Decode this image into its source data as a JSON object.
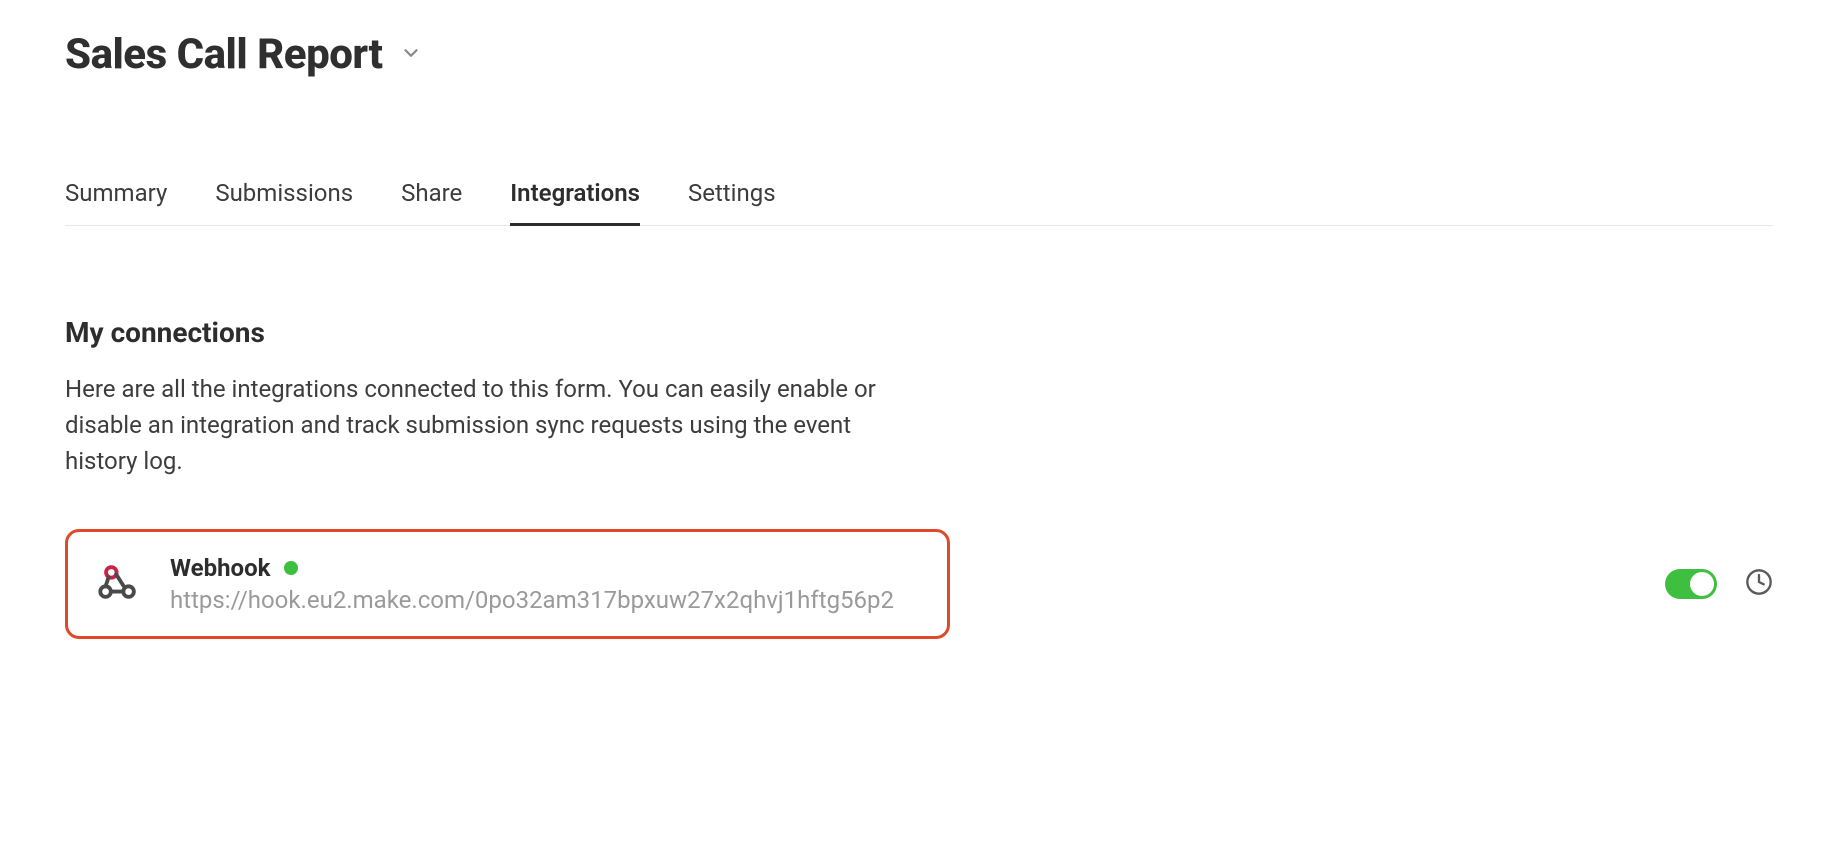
{
  "header": {
    "title": "Sales Call Report"
  },
  "tabs": [
    {
      "label": "Summary",
      "active": false
    },
    {
      "label": "Submissions",
      "active": false
    },
    {
      "label": "Share",
      "active": false
    },
    {
      "label": "Integrations",
      "active": true
    },
    {
      "label": "Settings",
      "active": false
    }
  ],
  "section": {
    "title": "My connections",
    "description": "Here are all the integrations connected to this form. You can easily enable or disable an integration and track submission sync requests using the event history log."
  },
  "connection": {
    "title": "Webhook",
    "status": "active",
    "url": "https://hook.eu2.make.com/0po32am317bpxuw27x2qhvj1hftg56p2",
    "enabled": true
  },
  "colors": {
    "accent_red": "#e04a2a",
    "status_green": "#3fbf3f"
  }
}
